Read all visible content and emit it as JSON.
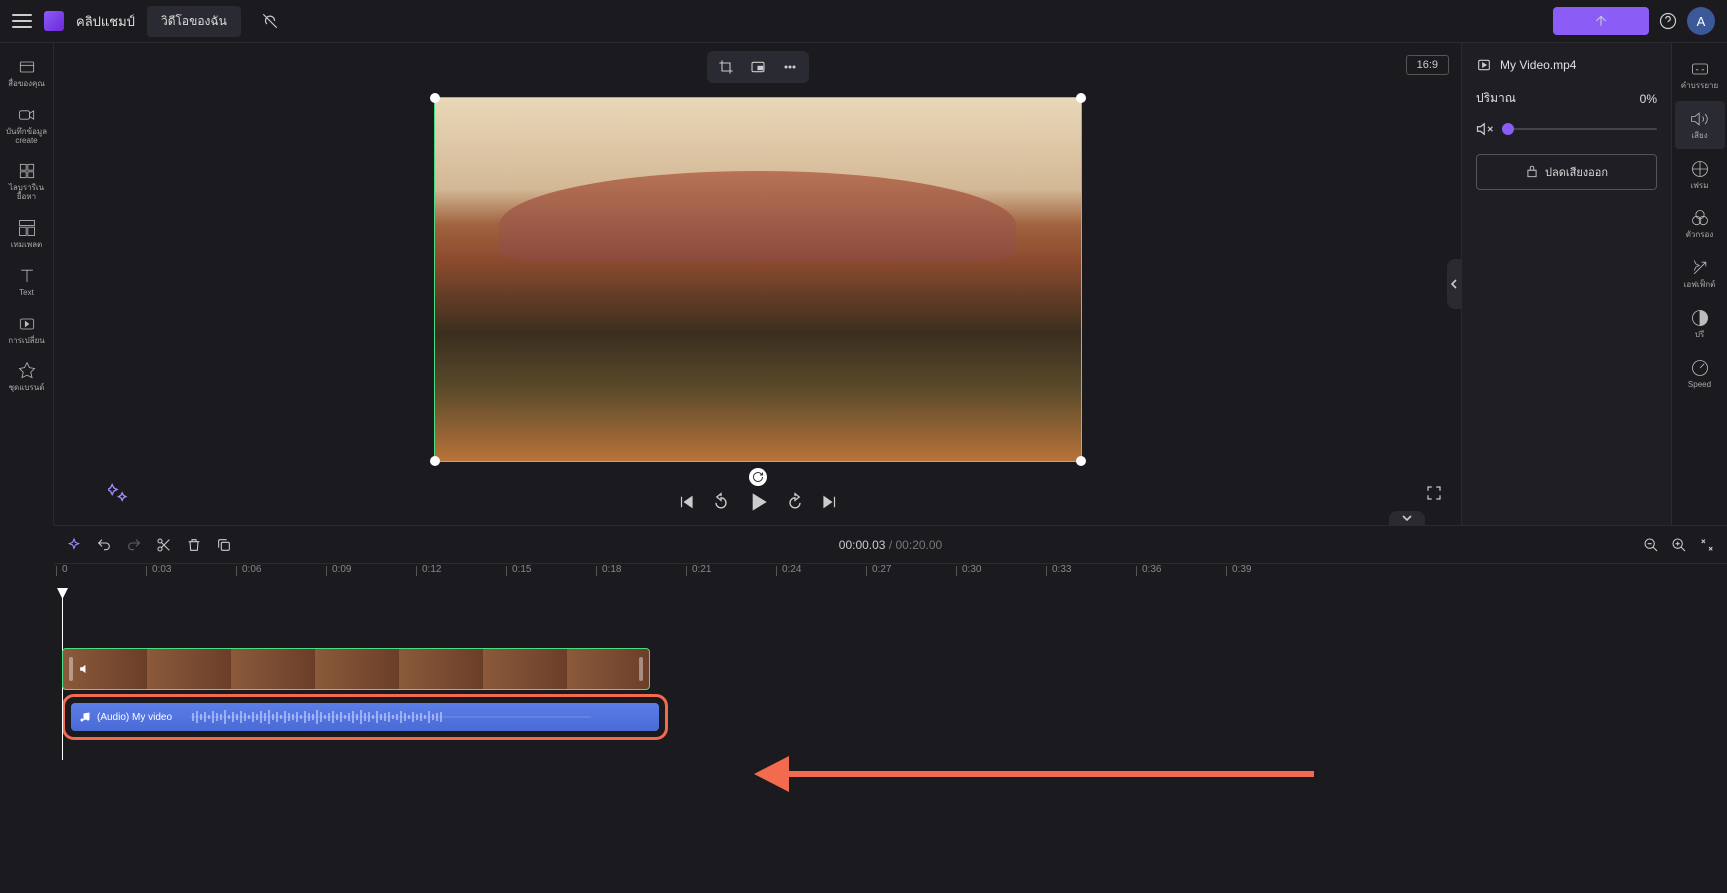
{
  "app": {
    "name": "คลิปแชมป์",
    "tab": "วิดีโอของฉัน"
  },
  "avatar": {
    "initial": "A"
  },
  "left_sidebar": {
    "items": [
      {
        "label": "สื่อของคุณ"
      },
      {
        "label": "บันทึกข้อมูล create"
      },
      {
        "label": "ไลบรารีเน ยื้อหา"
      },
      {
        "label": "เทมเพลต"
      },
      {
        "label": "Text"
      },
      {
        "label": "การเปลี่ยน"
      },
      {
        "label": "ชุดแบรนด์"
      }
    ]
  },
  "right_sidebar": {
    "items": [
      {
        "label": "คำบรรยาย"
      },
      {
        "label": "เสียง"
      },
      {
        "label": "เฟรม"
      },
      {
        "label": "ตัวกรอง"
      },
      {
        "label": "เอฟเฟ็กต์"
      },
      {
        "label": "ปรี"
      },
      {
        "label": "Speed"
      }
    ]
  },
  "preview": {
    "aspect": "16:9"
  },
  "properties": {
    "filename": "My Video.mp4",
    "volume_label": "ปริมาณ",
    "volume_value": "0%",
    "detach_audio": "ปลดเสียงออก"
  },
  "timeline": {
    "current_time": "00:00.03",
    "total_time": "00:20.00",
    "ruler": [
      "0",
      "0:03",
      "0:06",
      "0:09",
      "0:12",
      "0:15",
      "0:18",
      "0:21",
      "0:24",
      "0:27",
      "0:30",
      "0:33",
      "0:36",
      "0:39"
    ],
    "audio_clip_label": "(Audio) My video"
  }
}
